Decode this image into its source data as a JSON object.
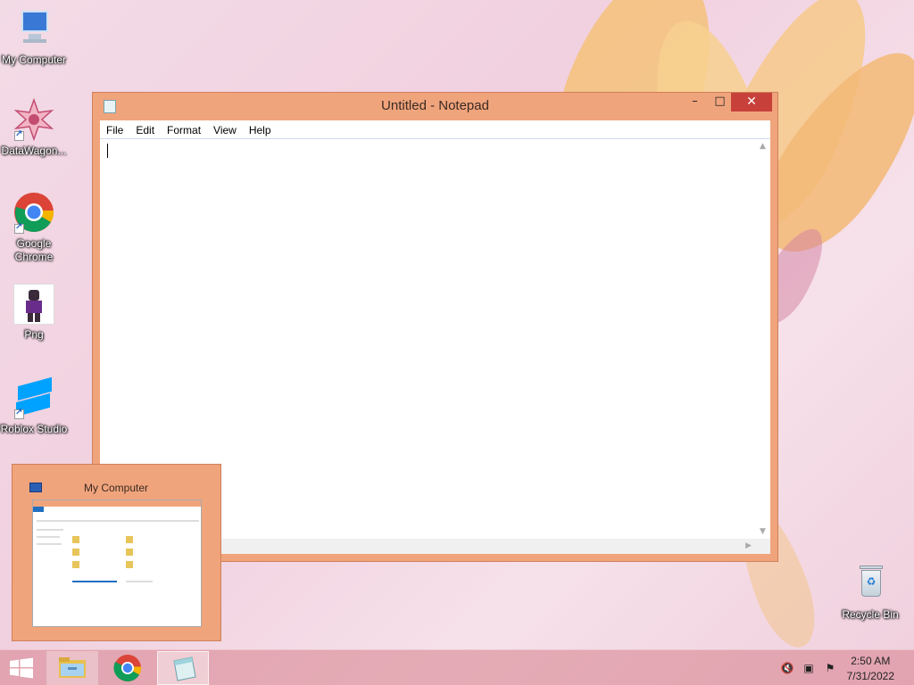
{
  "desktop": {
    "icons": [
      {
        "label": "My Computer"
      },
      {
        "label": "DataWagon..."
      },
      {
        "label": "Google Chrome"
      },
      {
        "label": "Png"
      },
      {
        "label": "Roblox Studio"
      },
      {
        "label": "Recycle Bin"
      }
    ]
  },
  "notepad": {
    "title": "Untitled - Notepad",
    "menu": [
      "File",
      "Edit",
      "Format",
      "View",
      "Help"
    ],
    "content": "",
    "buttons": {
      "minimize": "–",
      "maximize": "□",
      "close": "✕"
    }
  },
  "thumbnail": {
    "title": "My Computer"
  },
  "taskbar": {
    "items": [
      "start-icon",
      "file-explorer-icon",
      "chrome-icon",
      "notepad-icon"
    ],
    "active": "notepad-icon",
    "tray_icons": [
      "volume-muted-icon",
      "network-icon",
      "action-center-icon"
    ],
    "time": "2:50 AM",
    "date": "7/31/2022"
  },
  "colors": {
    "window_frame": "#f0a47c",
    "close_button": "#c7403a"
  }
}
